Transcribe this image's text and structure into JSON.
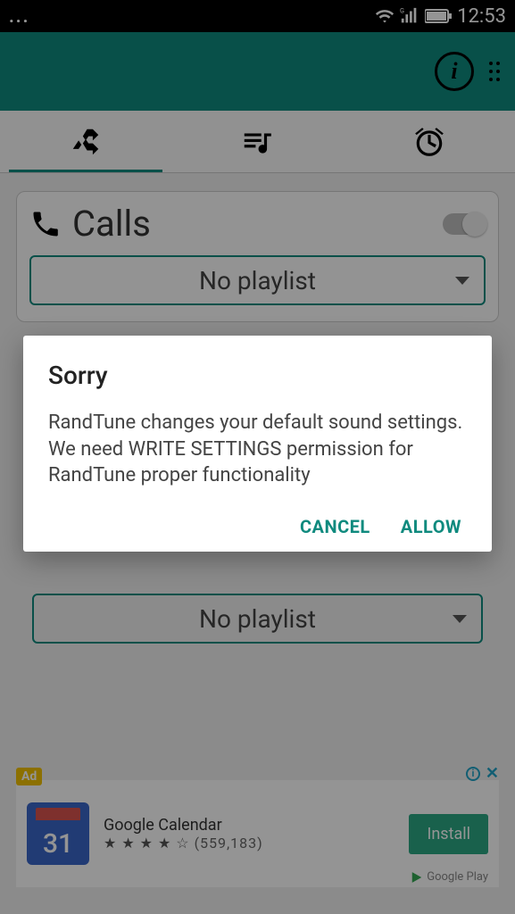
{
  "statusbar": {
    "time": "12:53"
  },
  "appbar": {
    "info_label": "i"
  },
  "sections": {
    "calls": {
      "title": "Calls",
      "playlist": "No playlist"
    },
    "lower_playlist": "No playlist"
  },
  "dialog": {
    "title": "Sorry",
    "body": "RandTune changes your default sound settings. We need WRITE SETTINGS permission for RandTune proper functionality",
    "cancel": "CANCEL",
    "allow": "ALLOW"
  },
  "ad": {
    "badge": "Ad",
    "icon_day": "31",
    "name": "Google Calendar",
    "stars_filled": "★ ★ ★ ★",
    "stars_empty": "☆",
    "reviews": "(559,183)",
    "install": "Install",
    "store": "Google Play"
  }
}
